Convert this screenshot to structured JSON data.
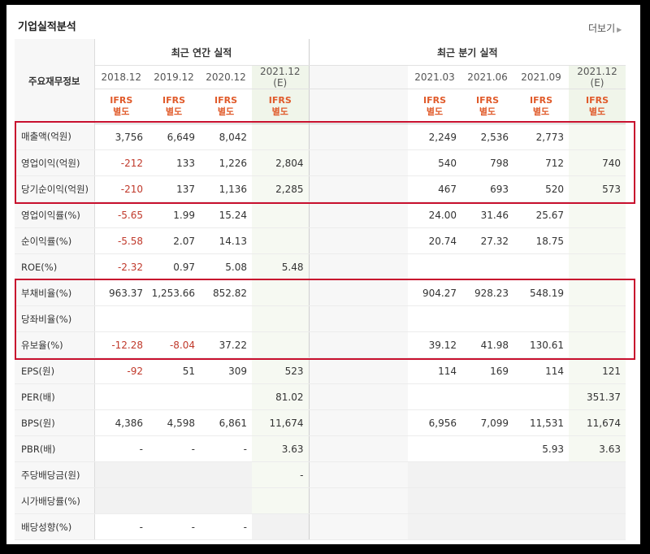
{
  "title": "기업실적분석",
  "more_link": "더보기",
  "header": {
    "row_label": "주요재무정보",
    "annual_group": "최근 연간 실적",
    "quarter_group": "최근 분기 실적",
    "annual_periods": [
      {
        "period": "2018.12",
        "note": ""
      },
      {
        "period": "2019.12",
        "note": ""
      },
      {
        "period": "2020.12",
        "note": ""
      },
      {
        "period": "2021.12",
        "note": "(E)"
      }
    ],
    "quarter_periods": [
      {
        "period": "2021.03",
        "note": ""
      },
      {
        "period": "2021.06",
        "note": ""
      },
      {
        "period": "2021.09",
        "note": ""
      },
      {
        "period": "2021.12",
        "note": "(E)"
      }
    ],
    "ifrs_top": "IFRS",
    "ifrs_bottom": "별도"
  },
  "rows": [
    {
      "label": "매출액(억원)",
      "annual": [
        "3,756",
        "6,649",
        "8,042",
        ""
      ],
      "quarter": [
        "2,249",
        "2,536",
        "2,773",
        ""
      ]
    },
    {
      "label": "영업이익(억원)",
      "annual": [
        "-212",
        "133",
        "1,226",
        "2,804"
      ],
      "quarter": [
        "540",
        "798",
        "712",
        "740"
      ]
    },
    {
      "label": "당기순이익(억원)",
      "annual": [
        "-210",
        "137",
        "1,136",
        "2,285"
      ],
      "quarter": [
        "467",
        "693",
        "520",
        "573"
      ]
    },
    {
      "label": "영업이익률(%)",
      "annual": [
        "-5.65",
        "1.99",
        "15.24",
        ""
      ],
      "quarter": [
        "24.00",
        "31.46",
        "25.67",
        ""
      ]
    },
    {
      "label": "순이익률(%)",
      "annual": [
        "-5.58",
        "2.07",
        "14.13",
        ""
      ],
      "quarter": [
        "20.74",
        "27.32",
        "18.75",
        ""
      ]
    },
    {
      "label": "ROE(%)",
      "annual": [
        "-2.32",
        "0.97",
        "5.08",
        "5.48"
      ],
      "quarter": [
        "",
        "",
        "",
        ""
      ]
    },
    {
      "label": "부채비율(%)",
      "annual": [
        "963.37",
        "1,253.66",
        "852.82",
        ""
      ],
      "quarter": [
        "904.27",
        "928.23",
        "548.19",
        ""
      ]
    },
    {
      "label": "당좌비율(%)",
      "annual": [
        "",
        "",
        "",
        ""
      ],
      "quarter": [
        "",
        "",
        "",
        ""
      ]
    },
    {
      "label": "유보율(%)",
      "annual": [
        "-12.28",
        "-8.04",
        "37.22",
        ""
      ],
      "quarter": [
        "39.12",
        "41.98",
        "130.61",
        ""
      ]
    },
    {
      "label": "EPS(원)",
      "annual": [
        "-92",
        "51",
        "309",
        "523"
      ],
      "quarter": [
        "114",
        "169",
        "114",
        "121"
      ]
    },
    {
      "label": "PER(배)",
      "annual": [
        "",
        "",
        "",
        "81.02"
      ],
      "quarter": [
        "",
        "",
        "",
        "351.37"
      ]
    },
    {
      "label": "BPS(원)",
      "annual": [
        "4,386",
        "4,598",
        "6,861",
        "11,674"
      ],
      "quarter": [
        "6,956",
        "7,099",
        "11,531",
        "11,674"
      ]
    },
    {
      "label": "PBR(배)",
      "annual": [
        "-",
        "-",
        "-",
        "3.63"
      ],
      "quarter": [
        "",
        "",
        "5.93",
        "3.63"
      ]
    },
    {
      "label": "주당배당금(원)",
      "annual": [
        "",
        "",
        "",
        "-"
      ],
      "quarter": [
        "",
        "",
        "",
        ""
      ],
      "gray": true
    },
    {
      "label": "시가배당률(%)",
      "annual": [
        "",
        "",
        "",
        ""
      ],
      "quarter": [
        "",
        "",
        "",
        ""
      ],
      "gray": true
    },
    {
      "label": "배당성향(%)",
      "annual": [
        "-",
        "-",
        "-",
        ""
      ],
      "quarter": [
        "",
        "",
        "",
        ""
      ],
      "gray_annual_only": false
    }
  ],
  "colors": {
    "highlight": "#c8102e",
    "negative": "#c0392b",
    "ifrs": "#e05a2a"
  }
}
